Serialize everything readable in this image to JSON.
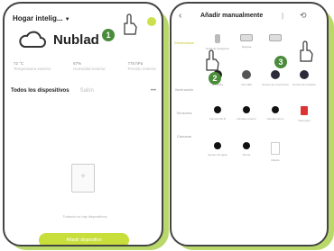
{
  "left": {
    "home": "Hogar intelig...",
    "weather": "Nublad",
    "stats": [
      {
        "value": "72 °C",
        "sub": "Temperatura exterior"
      },
      {
        "value": "67%",
        "sub": "Humedad exterior"
      },
      {
        "value": "775 hPa",
        "sub": "Presión exterior"
      }
    ],
    "devices_tab": "Todos los dispositivos",
    "devices_tab_2": "Salón",
    "dots": "•••",
    "empty_text": "Todavía no hay dispositivos",
    "add_button": "Añadir dispositivo"
  },
  "right": {
    "back": "‹",
    "title": "Añadir manualmente",
    "divider": "|",
    "scan": "⟲",
    "side_items": [
      "Electricistas",
      "",
      "Iluminación",
      "Sensores",
      "Cámaras"
    ],
    "devices": [
      {
        "label": "Enchufe inteligente",
        "icon": "plug"
      },
      {
        "label": "Regleta",
        "icon": "strip"
      },
      {
        "label": "",
        "icon": "strip"
      },
      {
        "label": "",
        "icon": "none"
      },
      {
        "label": "Bombilla",
        "icon": "bulb"
      },
      {
        "label": "Tira LED",
        "icon": "led"
      },
      {
        "label": "Sensor de movimiento",
        "icon": "sensor"
      },
      {
        "label": "Sensor de contacto",
        "icon": "sensor"
      },
      {
        "label": "Cámara Wi-Fi",
        "icon": "cam"
      },
      {
        "label": "Cámara exterior",
        "icon": "cam"
      },
      {
        "label": "Cámara domo",
        "icon": "cam"
      },
      {
        "label": "Interruptor",
        "icon": "switch"
      },
      {
        "label": "Sensor de agua",
        "icon": "cam"
      },
      {
        "label": "Sirena",
        "icon": "cam"
      },
      {
        "label": "Mando",
        "icon": "white"
      }
    ]
  },
  "badges": [
    "1",
    "2",
    "3"
  ],
  "colors": {
    "accent": "#c8de3a",
    "badge": "#4a8c3a",
    "shadow": "#b9d86a"
  }
}
